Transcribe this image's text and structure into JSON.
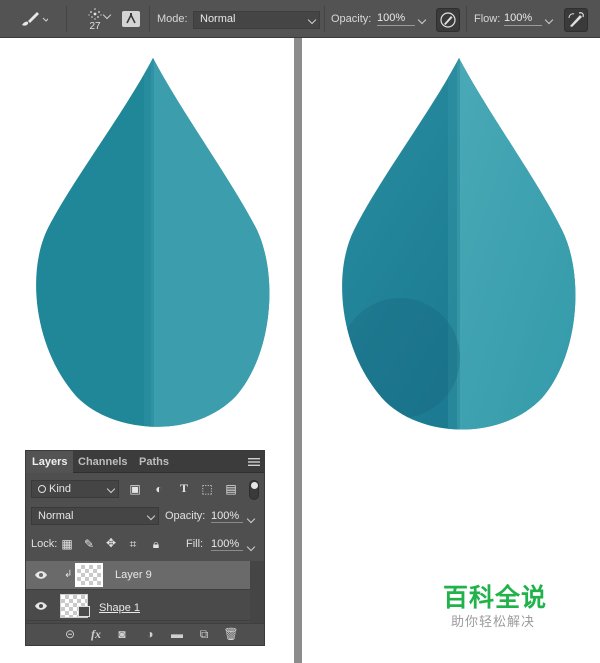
{
  "options_bar": {
    "brush_size": "27",
    "mode_label": "Mode:",
    "mode_value": "Normal",
    "opacity_label": "Opacity:",
    "opacity_value": "100%",
    "flow_label": "Flow:",
    "flow_value": "100%"
  },
  "colors": {
    "drop_light": "#3c9eac",
    "drop_dark": "#1f8798",
    "accent_watermark": "#21b24b"
  },
  "layers_panel": {
    "tabs": [
      "Layers",
      "Channels",
      "Paths"
    ],
    "filter_kind": "Kind",
    "blend_mode": "Normal",
    "opacity_label": "Opacity:",
    "opacity_value": "100%",
    "lock_label": "Lock:",
    "fill_label": "Fill:",
    "fill_value": "100%",
    "layers": [
      {
        "name": "Layer 9"
      },
      {
        "name": "Shape 1"
      }
    ]
  },
  "watermark": {
    "title": "百科全说",
    "subtitle": "助你轻松解决"
  }
}
